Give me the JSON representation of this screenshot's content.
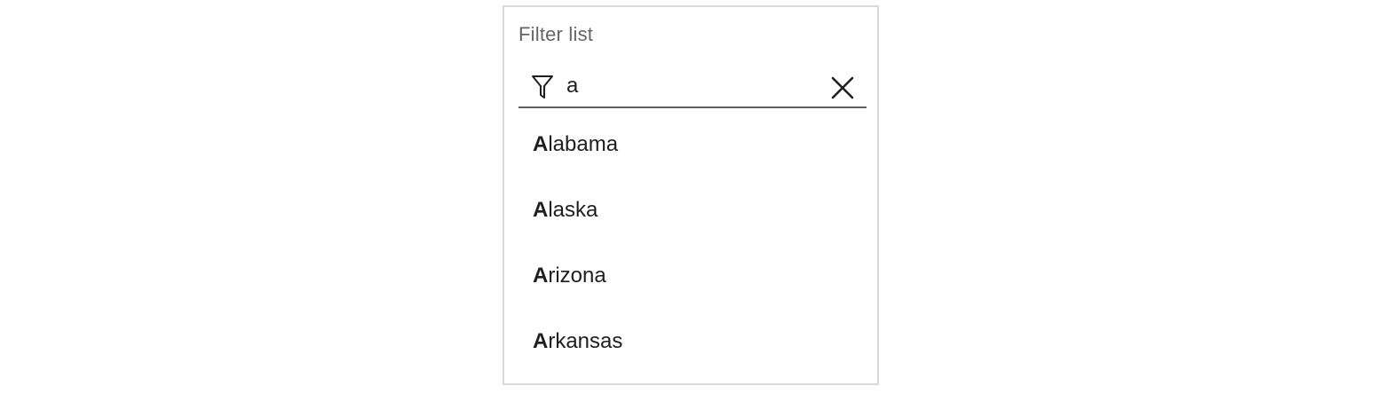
{
  "filter": {
    "label": "Filter list",
    "query": "a",
    "filter_icon": "filter-funnel-icon",
    "clear_icon": "close-icon"
  },
  "results": [
    {
      "match": "A",
      "rest": "labama"
    },
    {
      "match": "A",
      "rest": "laska"
    },
    {
      "match": "A",
      "rest": "rizona"
    },
    {
      "match": "A",
      "rest": "rkansas"
    }
  ],
  "colors": {
    "border": "#d9d9d9",
    "underline": "#5f5f5f",
    "label": "#666666",
    "text": "#1f1f1f"
  }
}
